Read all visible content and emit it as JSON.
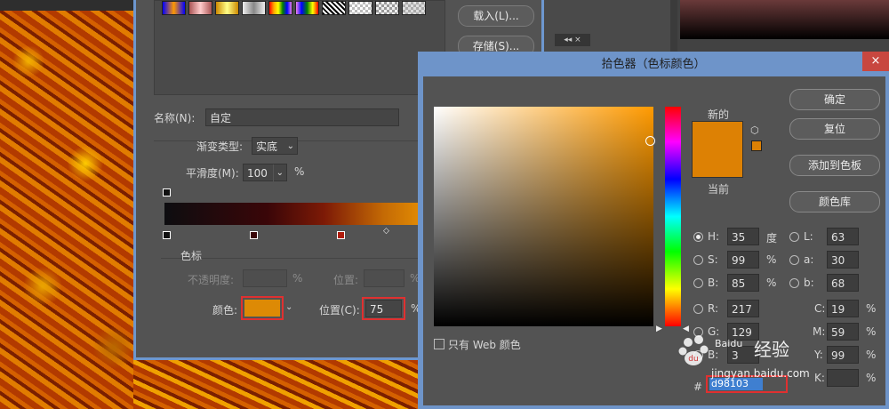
{
  "grad_editor": {
    "load_button": "载入(L)...",
    "save_button": "存储(S)...",
    "name_label": "名称(N):",
    "name_value": "自定",
    "type_label": "渐变类型:",
    "type_value": "实底",
    "smooth_label": "平滑度(M):",
    "smooth_value": "100",
    "smooth_unit": "%",
    "stops_group": "色标",
    "opacity_label": "不透明度:",
    "opacity_unit": "%",
    "opacity_pos_label": "位置:",
    "opacity_pos_unit": "%",
    "color_label": "颜色:",
    "color_pos_label": "位置(C):",
    "color_pos_value": "75",
    "color_pos_unit": "%",
    "stop_color": "#dd8a05"
  },
  "picker": {
    "title": "拾色器（色标颜色）",
    "close": "×",
    "new_label": "新的",
    "current_label": "当前",
    "ok_button": "确定",
    "reset_button": "复位",
    "add_swatch_button": "添加到色板",
    "libraries_button": "颜色库",
    "web_only_label": "只有 Web 颜色",
    "h_label": "H:",
    "h_value": "35",
    "h_unit": "度",
    "s_label": "S:",
    "s_value": "99",
    "s_unit": "%",
    "b_label": "B:",
    "b_value": "85",
    "b_unit": "%",
    "r_label": "R:",
    "r_value": "217",
    "g_label": "G:",
    "g_value": "129",
    "bb_label": "B:",
    "bb_value": "3",
    "l_label": "L:",
    "l_value": "63",
    "a_label": "a:",
    "a_value": "30",
    "lab_b_label": "b:",
    "lab_b_value": "68",
    "c_label": "C:",
    "c_value": "19",
    "c_unit": "%",
    "m_label": "M:",
    "m_value": "59",
    "m_unit": "%",
    "y_label": "Y:",
    "y_value": "99",
    "y_unit": "%",
    "k_label": "K:",
    "k_value": "",
    "k_unit": "%",
    "hex_label": "#",
    "hex_value": "d98103",
    "new_color": "#dd8104",
    "current_color": "#dd8104"
  },
  "watermark": {
    "brand": "Baidu",
    "name": "经验",
    "url": "jingyan.baidu.com"
  }
}
